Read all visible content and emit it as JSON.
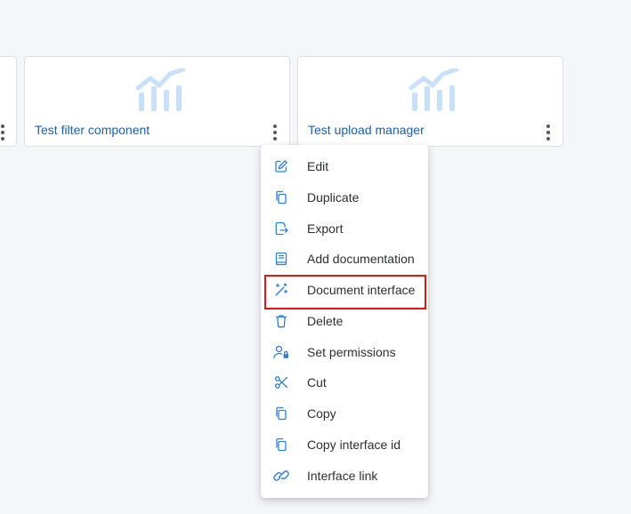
{
  "cards": [
    {
      "title": ""
    },
    {
      "title": "Test filter component"
    },
    {
      "title": "Test upload manager"
    }
  ],
  "context_menu": {
    "items": [
      {
        "label": "Edit",
        "icon": "edit-icon"
      },
      {
        "label": "Duplicate",
        "icon": "duplicate-icon"
      },
      {
        "label": "Export",
        "icon": "export-icon"
      },
      {
        "label": "Add documentation",
        "icon": "book-icon"
      },
      {
        "label": "Document interface",
        "icon": "magic-wand-icon"
      },
      {
        "label": "Delete",
        "icon": "trash-icon"
      },
      {
        "label": "Set permissions",
        "icon": "user-lock-icon"
      },
      {
        "label": "Cut",
        "icon": "scissors-icon"
      },
      {
        "label": "Copy",
        "icon": "copy-icon"
      },
      {
        "label": "Copy interface id",
        "icon": "copy-icon"
      },
      {
        "label": "Interface link",
        "icon": "link-icon"
      }
    ],
    "highlighted_item": "Document interface"
  },
  "colors": {
    "accent": "#2f7fd0",
    "title_text": "#1d5fa8",
    "chart_icon": "#c9e1f8",
    "highlight": "#e01414"
  }
}
